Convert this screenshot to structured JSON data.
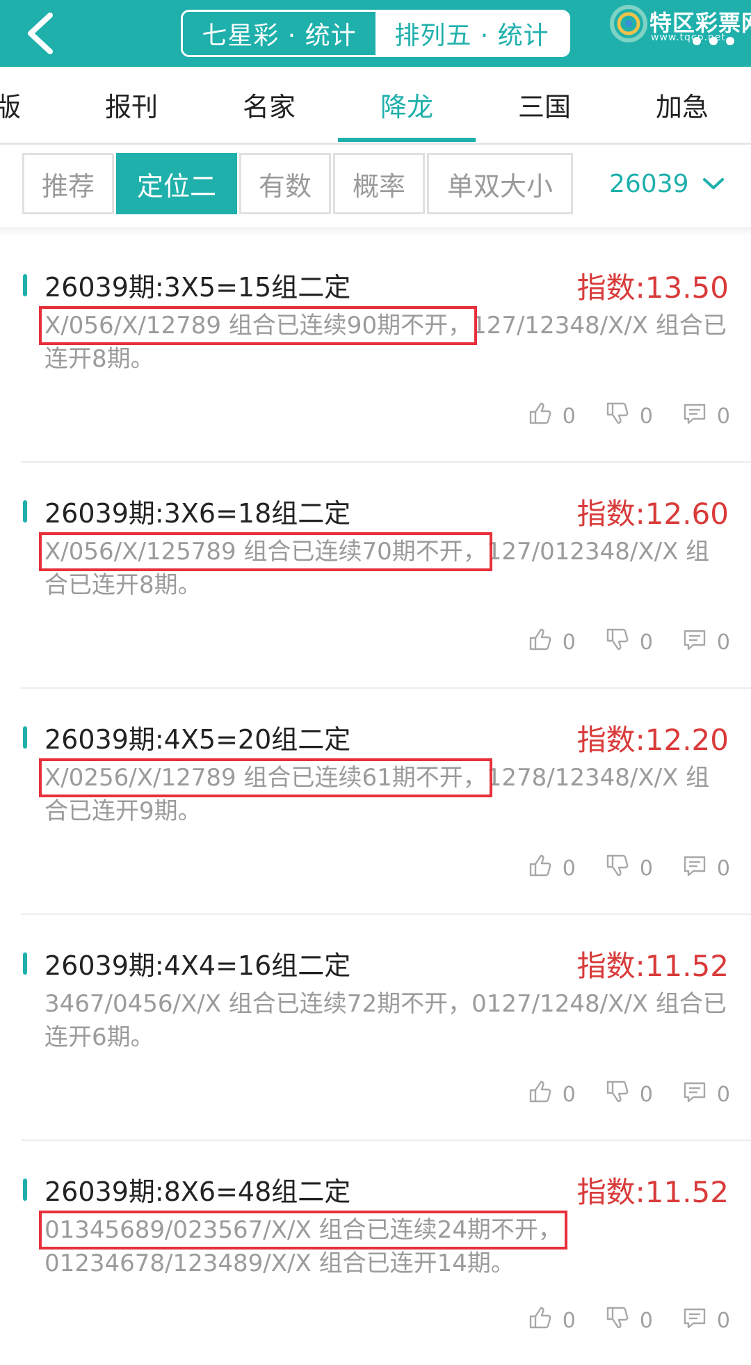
{
  "header": {
    "segments": [
      {
        "label": "七星彩 · 统计",
        "active": true
      },
      {
        "label": "排列五 · 统计",
        "active": false
      }
    ],
    "brand": {
      "name": "特区彩票网",
      "url": "www.tqcp.net"
    }
  },
  "category_tabs": [
    "版",
    "报刊",
    "名家",
    "降龙",
    "三国",
    "加急"
  ],
  "active_category": "降龙",
  "sub_tabs": [
    "推荐",
    "定位二",
    "有数",
    "概率",
    "单双大小"
  ],
  "active_sub_tab": "定位二",
  "period_selector": {
    "value": "26039"
  },
  "cards": [
    {
      "title": "26039期:3X5=15组二定",
      "score": "指数:13.50",
      "highlight": "X/056/X/12789 组合已连续90期不开，",
      "rest": "127/12348/X/X 组合已连开8期。",
      "likes": "0",
      "dislikes": "0",
      "comments": "0"
    },
    {
      "title": "26039期:3X6=18组二定",
      "score": "指数:12.60",
      "highlight": "X/056/X/125789 组合已连续70期不开，",
      "rest": "127/012348/X/X 组合已连开8期。",
      "likes": "0",
      "dislikes": "0",
      "comments": "0"
    },
    {
      "title": "26039期:4X5=20组二定",
      "score": "指数:12.20",
      "highlight": "X/0256/X/12789 组合已连续61期不开，",
      "rest": "1278/12348/X/X 组合已连开9期。",
      "likes": "0",
      "dislikes": "0",
      "comments": "0"
    },
    {
      "title": "26039期:4X4=16组二定",
      "score": "指数:11.52",
      "highlight": "",
      "rest": "3467/0456/X/X 组合已连续72期不开，0127/1248/X/X 组合已连开6期。",
      "likes": "0",
      "dislikes": "0",
      "comments": "0"
    },
    {
      "title": "26039期:8X6=48组二定",
      "score": "指数:11.52",
      "highlight": "01345689/023567/X/X 组合已连续24期不开，",
      "rest": "01234678/123489/X/X 组合已连开14期。",
      "likes": "0",
      "dislikes": "0",
      "comments": "0"
    }
  ]
}
